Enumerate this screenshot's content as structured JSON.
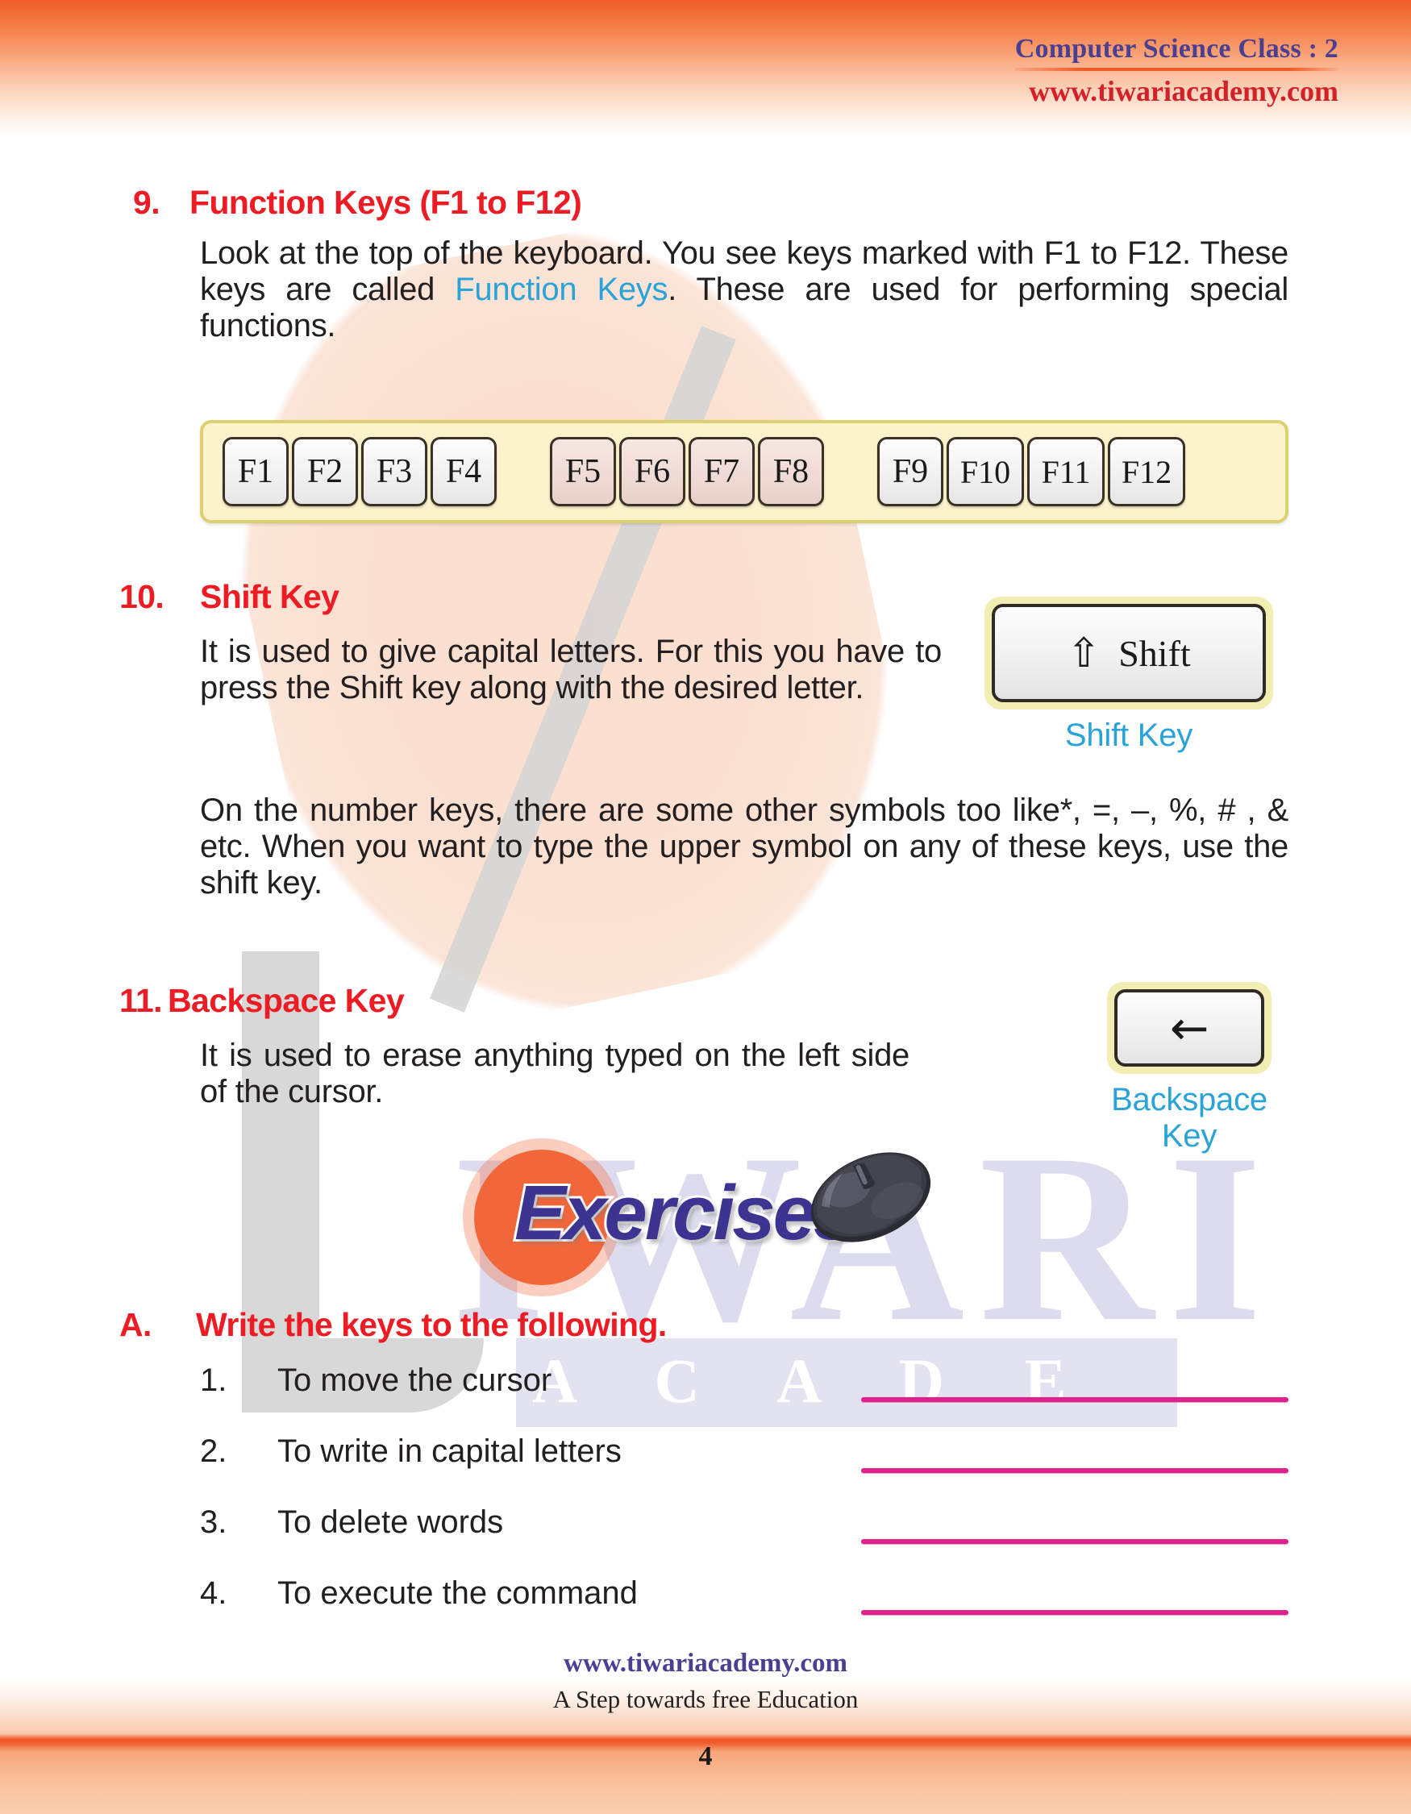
{
  "header": {
    "title": "Computer Science Class : 2",
    "url": "www.tiwariacademy.com"
  },
  "watermark": {
    "word_primary": "IWARI",
    "word_secondary": "A C A D E M Y"
  },
  "sections": [
    {
      "number": "9.",
      "title": "Function Keys (F1 to F12)",
      "body_prefix": "Look at the top of the keyboard. You see keys marked with F1 to F12. These keys are called ",
      "body_highlight": "Function Keys",
      "body_suffix": ". These are used for performing special functions."
    },
    {
      "number": "10.",
      "title": "Shift Key",
      "paragraph_1": "It is used to give capital letters. For this you have to press the Shift key along with the desired letter.",
      "paragraph_2": "On the number keys, there are some other symbols too like*, =, –, %, # , & etc. When you want to type the upper symbol on any of these keys, use the shift key."
    },
    {
      "number": "11.",
      "title": "Backspace Key",
      "paragraph_1": "It is used to erase anything typed on the left side of the cursor."
    }
  ],
  "function_keys": {
    "group_1": [
      "F1",
      "F2",
      "F3",
      "F4"
    ],
    "group_2": [
      "F5",
      "F6",
      "F7",
      "F8"
    ],
    "group_3": [
      "F9",
      "F10",
      "F11",
      "F12"
    ]
  },
  "figures": {
    "shift": {
      "glyph": "shift-arrow-icon",
      "glyph_char": "⇧",
      "label": "Shift",
      "caption": "Shift Key"
    },
    "backspace": {
      "glyph": "left-arrow-icon",
      "glyph_char": "←",
      "caption": "Backspace Key"
    }
  },
  "exercises": {
    "banner_word": "Exercises",
    "part_letter": "A.",
    "part_title": "Write the keys to the following.",
    "questions": [
      {
        "number": "1.",
        "text": "To move the cursor"
      },
      {
        "number": "2.",
        "text": "To write in capital letters"
      },
      {
        "number": "3.",
        "text": "To delete words"
      },
      {
        "number": "4.",
        "text": "To execute the command"
      }
    ]
  },
  "footer": {
    "url": "www.tiwariacademy.com",
    "tagline": "A Step towards free Education",
    "page_number": "4"
  },
  "colors": {
    "heading_red": "#ed1c24",
    "highlight_blue": "#29a3d8",
    "header_purple": "#4b3f91",
    "header_red": "#d42027",
    "blank_magenta": "#e0218a",
    "banner_orange": "#f2673a",
    "banner_purple": "#3d3391",
    "panel_cream": "#fcf3cd",
    "panel_border": "#ddd071"
  }
}
